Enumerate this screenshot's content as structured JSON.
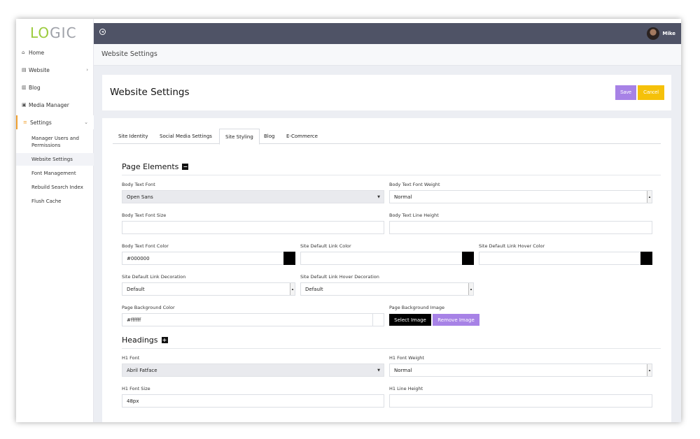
{
  "logo": {
    "accent": "LO",
    "rest": "GIC",
    "accent_color": "#9bcb3c"
  },
  "sidebar": {
    "items": [
      {
        "label": "Home",
        "icon": "home-icon"
      },
      {
        "label": "Website",
        "icon": "website-icon"
      },
      {
        "label": "Blog",
        "icon": "blog-icon"
      },
      {
        "label": "Media Manager",
        "icon": "media-icon"
      },
      {
        "label": "Settings",
        "icon": "settings-icon"
      }
    ],
    "sub_items": [
      {
        "label": "Manager Users and Permissions"
      },
      {
        "label": "Website Settings"
      },
      {
        "label": "Font Management"
      },
      {
        "label": "Rebuild Search Index"
      },
      {
        "label": "Flush Cache"
      }
    ]
  },
  "topbar": {
    "user_name": "Mike",
    "bg_color": "#4f5366"
  },
  "breadcrumb": {
    "text": "Website Settings"
  },
  "header": {
    "title": "Website Settings",
    "save_label": "Save",
    "cancel_label": "Cancel"
  },
  "tabs": [
    {
      "label": "Site Identity"
    },
    {
      "label": "Social Media Settings"
    },
    {
      "label": "Site Styling"
    },
    {
      "label": "Blog"
    },
    {
      "label": "E-Commerce"
    }
  ],
  "page_elements": {
    "title": "Page Elements",
    "toggle_symbol": "−",
    "body_text_font_label": "Body Text Font",
    "body_text_font_value": "Open Sans",
    "body_text_font_weight_label": "Body Text Font Weight",
    "body_text_font_weight_value": "Normal",
    "body_text_font_size_label": "Body Text Font Size",
    "body_text_font_size_value": "",
    "body_text_line_height_label": "Body Text Line Height",
    "body_text_line_height_value": "",
    "body_text_font_color_label": "Body Text Font Color",
    "body_text_font_color_value": "#000000",
    "site_default_link_color_label": "Site Default Link Color",
    "site_default_link_color_value": "",
    "site_default_link_hover_color_label": "Site Default Link Hover Color",
    "site_default_link_hover_color_value": "",
    "site_default_link_decoration_label": "Site Default Link Decoration",
    "site_default_link_decoration_value": "Default",
    "site_default_link_hover_decoration_label": "Site Default Link Hover Decoration",
    "site_default_link_hover_decoration_value": "Default",
    "page_background_color_label": "Page Background Color",
    "page_background_color_value": "#ffffff",
    "page_background_image_label": "Page Background Image",
    "select_image_label": "Select Image",
    "remove_image_label": "Remove Image"
  },
  "headings": {
    "title": "Headings",
    "toggle_symbol": "+",
    "h1_font_label": "H1 Font",
    "h1_font_value": "Abril Fatface",
    "h1_font_weight_label": "H1 Font Weight",
    "h1_font_weight_value": "Normal",
    "h1_font_size_label": "H1 Font Size",
    "h1_font_size_value": "48px",
    "h1_line_height_label": "H1 Line Height",
    "h1_line_height_value": ""
  }
}
